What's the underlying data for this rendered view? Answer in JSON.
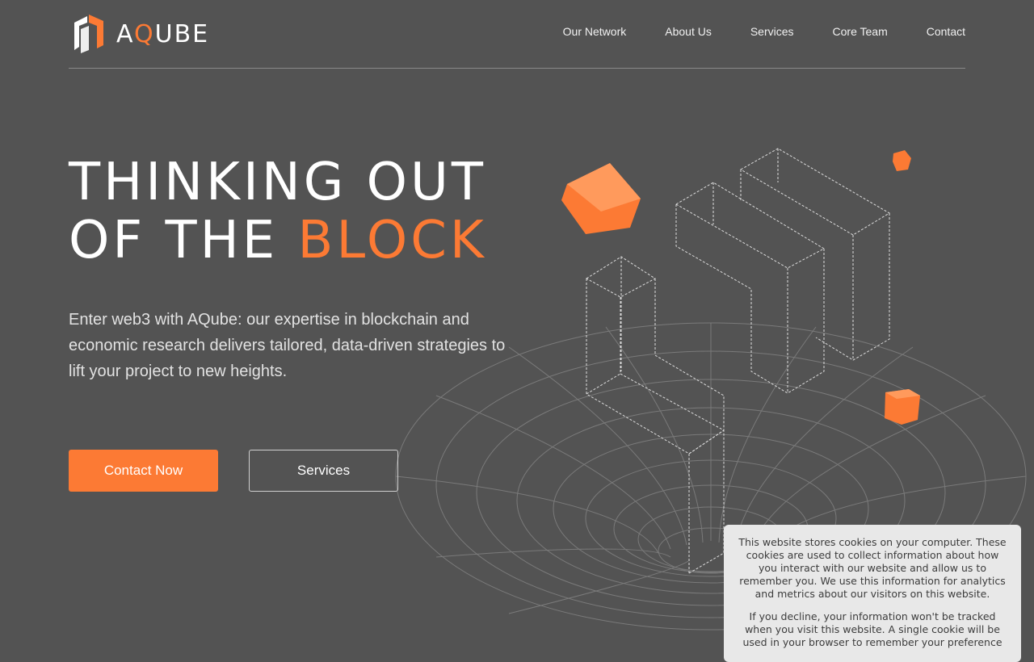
{
  "brand": {
    "name_prefix": "A",
    "name_q": "Q",
    "name_suffix": "UBE"
  },
  "nav": {
    "items": [
      "Our Network",
      "About Us",
      "Services",
      "Core Team",
      "Contact"
    ]
  },
  "hero": {
    "title_line1": "THINKING OUT",
    "title_line2_plain": "OF THE ",
    "title_line2_accent": "BLOCK",
    "description": "Enter web3 with AQube: our expertise in blockchain and economic research delivers tailored, data-driven strategies to lift your project to new heights.",
    "primary_button": "Contact Now",
    "secondary_button": "Services"
  },
  "cookie_banner": {
    "paragraph1": "This website stores cookies on your computer. These cookies are used to collect information about how you interact with our website and allow us to remember you. We use this information for analytics and metrics about our visitors on this website.",
    "paragraph2": "If you decline, your information won't be tracked when you visit this website. A single cookie will be used in your browser to remember your preference"
  },
  "colors": {
    "background": "#535353",
    "accent": "#fc7a34",
    "text": "#ffffff",
    "cookie_bg": "#e8e8e8"
  },
  "icons": [
    "aqube-logo-icon",
    "orange-cube-icon",
    "wireframe-blocks-graphic",
    "wormhole-grid-graphic"
  ]
}
